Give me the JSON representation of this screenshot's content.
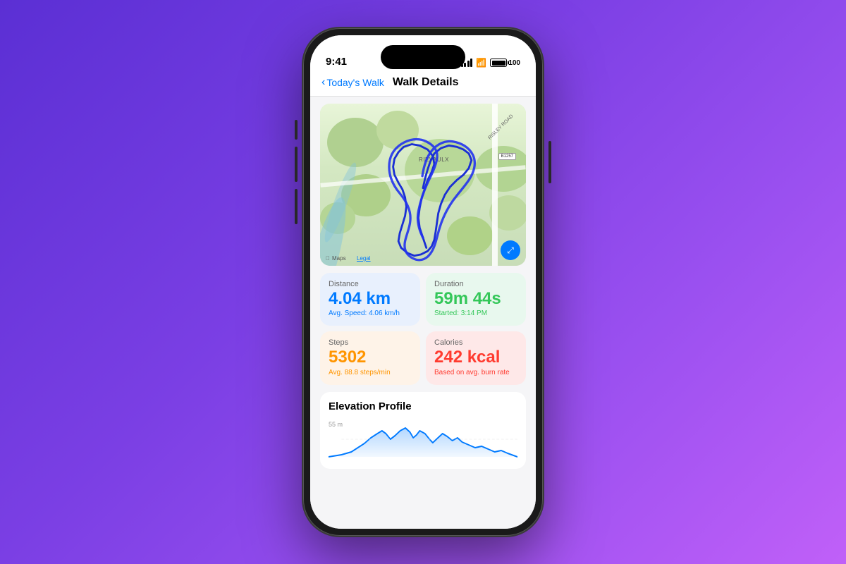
{
  "status_bar": {
    "time": "9:41",
    "battery_percent": "100"
  },
  "nav": {
    "back_label": "Today's Walk",
    "title": "Walk Details"
  },
  "map": {
    "attribution": "Maps",
    "legal": "Legal",
    "place_name": "RIEVAULX",
    "road_label": "B1257",
    "expand_icon": "⤢"
  },
  "stats": {
    "distance": {
      "label": "Distance",
      "value": "4.04 km",
      "sub": "Avg. Speed: 4.06 km/h"
    },
    "duration": {
      "label": "Duration",
      "value": "59m 44s",
      "sub": "Started: 3:14 PM"
    },
    "steps": {
      "label": "Steps",
      "value": "5302",
      "sub": "Avg. 88.8 steps/min"
    },
    "calories": {
      "label": "Calories",
      "value": "242 kcal",
      "sub": "Based on avg. burn rate"
    }
  },
  "elevation": {
    "title": "Elevation Profile",
    "label": "55 m"
  }
}
